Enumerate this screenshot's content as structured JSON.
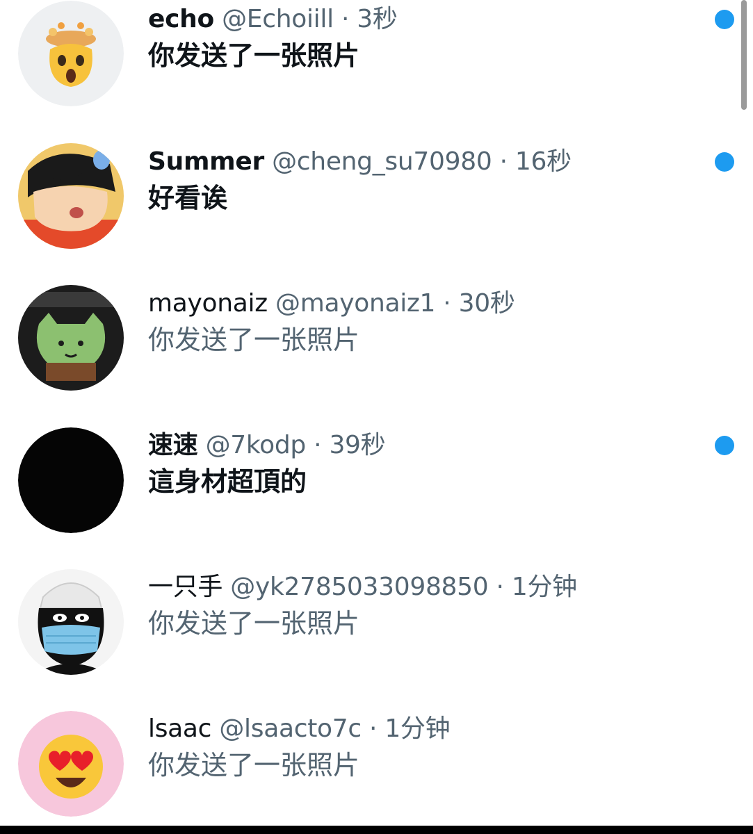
{
  "conversations": [
    {
      "name": "echo",
      "handle": "@Echoiill",
      "separator": "·",
      "time": "3秒",
      "preview": "你发送了一张照片",
      "unread": true,
      "avatar": "shocked-emoji-avatar"
    },
    {
      "name": "Summer",
      "handle": "@cheng_su70980",
      "separator": "·",
      "time": "16秒",
      "preview": "好看诶",
      "unread": true,
      "avatar": "cartoon-boy-avatar"
    },
    {
      "name": "mayonaiz",
      "handle": "@mayonaiz1",
      "separator": "·",
      "time": "30秒",
      "preview": "你发送了一张照片",
      "unread": false,
      "avatar": "green-cat-avatar"
    },
    {
      "name": "速速",
      "handle": "@7kodp",
      "separator": "·",
      "time": "39秒",
      "preview": "這身材超頂的",
      "unread": true,
      "avatar": "black-avatar"
    },
    {
      "name": "一只手",
      "handle": "@yk2785033098850",
      "separator": "·",
      "time": "1分钟",
      "preview": "你发送了一张照片",
      "unread": false,
      "avatar": "masked-figure-avatar"
    },
    {
      "name": "lsaac",
      "handle": "@lsaacto7c",
      "separator": "·",
      "time": "1分钟",
      "preview": "你发送了一张照片",
      "unread": false,
      "avatar": "heart-eyes-emoji-avatar"
    }
  ],
  "colors": {
    "unread_dot": "#1d9bf0",
    "primary_text": "#0f1419",
    "secondary_text": "#536471"
  }
}
